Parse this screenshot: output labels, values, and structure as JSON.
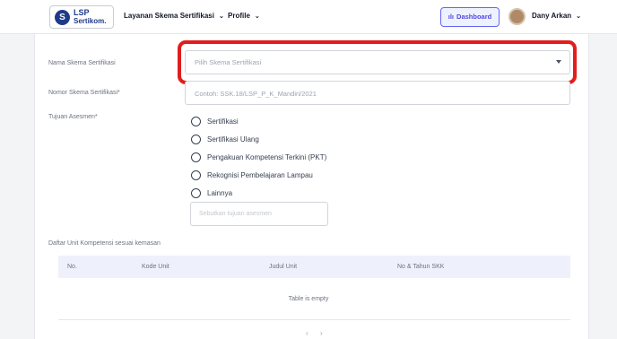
{
  "nav": {
    "logo_mark": "S",
    "logo_top": "LSP",
    "logo_bottom": "Sertikom.",
    "menu_layanan": "Layanan Skema Sertifikasi",
    "menu_profile": "Profile",
    "dashboard_label": "Dashboard",
    "user_name": "Dany Arkan"
  },
  "form": {
    "skema_label": "Nama Skema Sertifikasi",
    "skema_placeholder": "Pilih Skema Sertifikasi",
    "nomor_label": "Nomor Skema Sertifikasi*",
    "nomor_placeholder": "Contoh: SSK.18/LSP_P_K_Mandiri/2021",
    "tujuan_label": "Tujuan Asesmen*",
    "tujuan_options": [
      "Sertifikasi",
      "Sertifikasi Ulang",
      "Pengakuan Kompetensi Terkini (PKT)",
      "Rekognisi Pembelajaran Lampau",
      "Lainnya"
    ],
    "lainnya_placeholder": "Sebutkan tujuan asesmen"
  },
  "table": {
    "title": "Daftar Unit Kompetensi sesuai kemasan",
    "columns": [
      "No.",
      "Kode Unit",
      "Judul Unit",
      "No & Tahun SKK"
    ],
    "empty_text": "Table is empty"
  },
  "pagination": {
    "prev": "‹",
    "next": "›"
  },
  "colors": {
    "accent": "#4f46e5",
    "highlight": "#e11d1d",
    "brand": "#1e3a8a"
  }
}
